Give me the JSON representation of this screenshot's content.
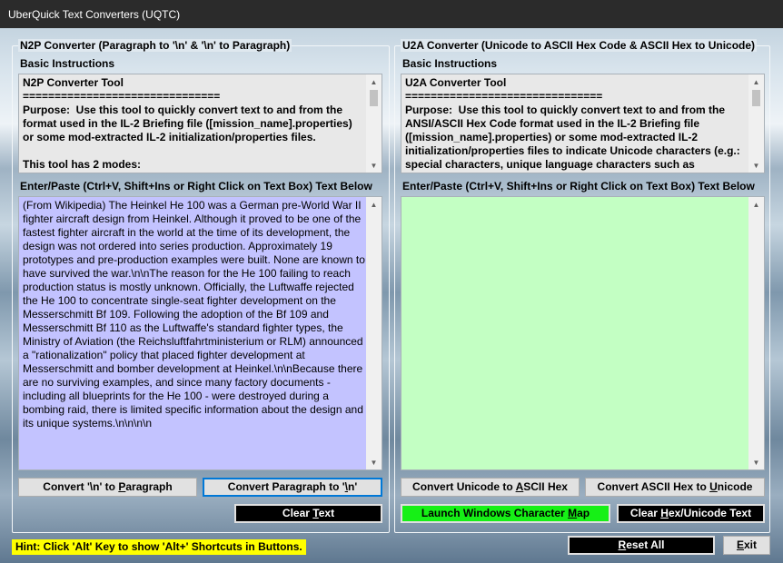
{
  "window": {
    "title": "UberQuick Text Converters (UQTC)"
  },
  "n2p": {
    "group_title": "N2P Converter (Paragraph to '\\n' & '\\n' to Paragraph)",
    "instructions_label": "Basic Instructions",
    "instructions_text": "N2P Converter Tool\n===============================\nPurpose:  Use this tool to quickly convert text to and from the format used in the IL-2 Briefing file ([mission_name].properties) or some mod-extracted IL-2 initialization/properties files.\n\nThis tool has 2 modes:",
    "entry_label": "Enter/Paste (Ctrl+V, Shift+Ins or Right Click on Text Box) Text Below",
    "entry_text": "(From Wikipedia) The Heinkel He 100 was a German pre-World War II fighter aircraft design from Heinkel. Although it proved to be one of the fastest fighter aircraft in the world at the time of its development, the design was not ordered into series production. Approximately 19 prototypes and pre-production examples were built. None are known to have survived the war.\\n\\nThe reason for the He 100 failing to reach production status is mostly unknown. Officially, the Luftwaffe rejected the He 100 to concentrate single-seat fighter development on the Messerschmitt Bf 109. Following the adoption of the Bf 109 and Messerschmitt Bf 110 as the Luftwaffe's standard fighter types, the Ministry of Aviation (the Reichsluftfahrtministerium or RLM) announced a \"rationalization\" policy that placed fighter development at Messerschmitt and bomber development at Heinkel.\\n\\nBecause there are no surviving examples, and since many factory documents - including all blueprints for the He 100 - were destroyed during a bombing raid, there is limited specific information about the design and its unique systems.\\n\\n\\n\\n",
    "btn_to_paragraph": {
      "pre": "Convert '\\n' to ",
      "key": "P",
      "post": "aragraph"
    },
    "btn_to_n": {
      "pre": "Convert Paragraph to '",
      "key": "\\",
      "post": "n'"
    },
    "btn_clear": {
      "pre": "Clear ",
      "key": "T",
      "post": "ext"
    },
    "entry_color": "#c3c3ff"
  },
  "u2a": {
    "group_title": "U2A Converter (Unicode to ASCII Hex Code & ASCII Hex to Unicode)",
    "instructions_label": "Basic Instructions",
    "instructions_text": "U2A Converter Tool\n===============================\nPurpose:  Use this tool to quickly convert text to and from the ANSI/ASCII Hex Code format used in the IL-2 Briefing file ([mission_name].properties) or some mod-extracted IL-2 initialization/properties files to indicate Unicode characters (e.g.: special characters, unique language characters such as Japanese,",
    "entry_label": "Enter/Paste (Ctrl+V, Shift+Ins or Right Click on Text Box) Text Below",
    "entry_text": "",
    "btn_to_hex": {
      "pre": "Convert Unicode to ",
      "key": "A",
      "post": "SCII Hex"
    },
    "btn_to_unicode": {
      "pre": "Convert ASCII Hex to ",
      "key": "U",
      "post": "nicode"
    },
    "btn_charmap": {
      "pre": "Launch Windows Character ",
      "key": "M",
      "post": "ap"
    },
    "btn_clear": {
      "pre": "Clear ",
      "key": "H",
      "post": "ex/Unicode Text"
    },
    "entry_color": "#c3ffc3",
    "charmap_color": "#16f016"
  },
  "footer": {
    "hint": "Hint:  Click 'Alt' Key to show 'Alt+' Shortcuts in Buttons.",
    "btn_reset": {
      "pre": "",
      "key": "R",
      "post": "eset All"
    },
    "btn_exit": {
      "pre": "",
      "key": "E",
      "post": "xit"
    }
  }
}
